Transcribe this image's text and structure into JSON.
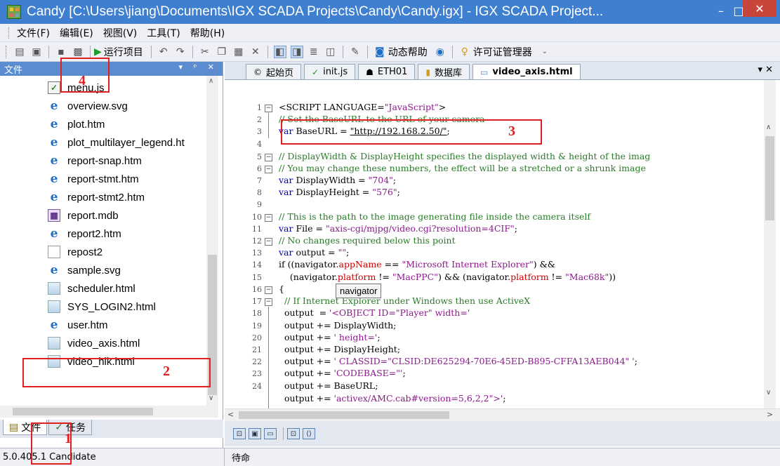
{
  "window": {
    "title": "Candy [C:\\Users\\jiang\\Documents\\IGX SCADA Projects\\Candy\\Candy.igx] - IGX SCADA Project...",
    "minimize": "–",
    "maximize": "□",
    "close": "✕"
  },
  "menu": [
    "文件(F)",
    "编辑(E)",
    "视图(V)",
    "工具(T)",
    "帮助(H)"
  ],
  "toolbar": {
    "run_label": "运行项目",
    "help_label": "动态帮助",
    "license_label": "许可证管理器"
  },
  "left_panel": {
    "title": "文件",
    "header_buttons": "▾ ᵖ ✕",
    "files": [
      {
        "name": "menu.js",
        "icon": "js-file-icon"
      },
      {
        "name": "overview.svg",
        "icon": "ie-file-icon"
      },
      {
        "name": "plot.htm",
        "icon": "ie-file-icon"
      },
      {
        "name": "plot_multilayer_legend.ht",
        "icon": "ie-file-icon"
      },
      {
        "name": "report-snap.htm",
        "icon": "ie-file-icon"
      },
      {
        "name": "report-stmt.htm",
        "icon": "ie-file-icon"
      },
      {
        "name": "report-stmt2.htm",
        "icon": "ie-file-icon"
      },
      {
        "name": "report.mdb",
        "icon": "mdb-file-icon"
      },
      {
        "name": "report2.htm",
        "icon": "ie-file-icon"
      },
      {
        "name": "repost2",
        "icon": "blank-file-icon"
      },
      {
        "name": "sample.svg",
        "icon": "ie-file-icon"
      },
      {
        "name": "scheduler.html",
        "icon": "html-file-icon"
      },
      {
        "name": "SYS_LOGIN2.html",
        "icon": "html-file-icon"
      },
      {
        "name": "user.htm",
        "icon": "ie-file-icon"
      },
      {
        "name": "video_axis.html",
        "icon": "html-file-icon"
      },
      {
        "name": "video_hik.html",
        "icon": "html-file-icon"
      }
    ],
    "tabs": [
      "文件",
      "任务"
    ]
  },
  "editor": {
    "tabs": [
      "起始页",
      "init.js",
      "ETH01",
      "数据库",
      "video_axis.html"
    ],
    "tooltip": "navigator"
  },
  "status": {
    "version": "5.0.405.1 Candidate",
    "state": "待命"
  },
  "annotations": {
    "n1": "1",
    "n2": "2",
    "n3": "3",
    "n4": "4"
  }
}
